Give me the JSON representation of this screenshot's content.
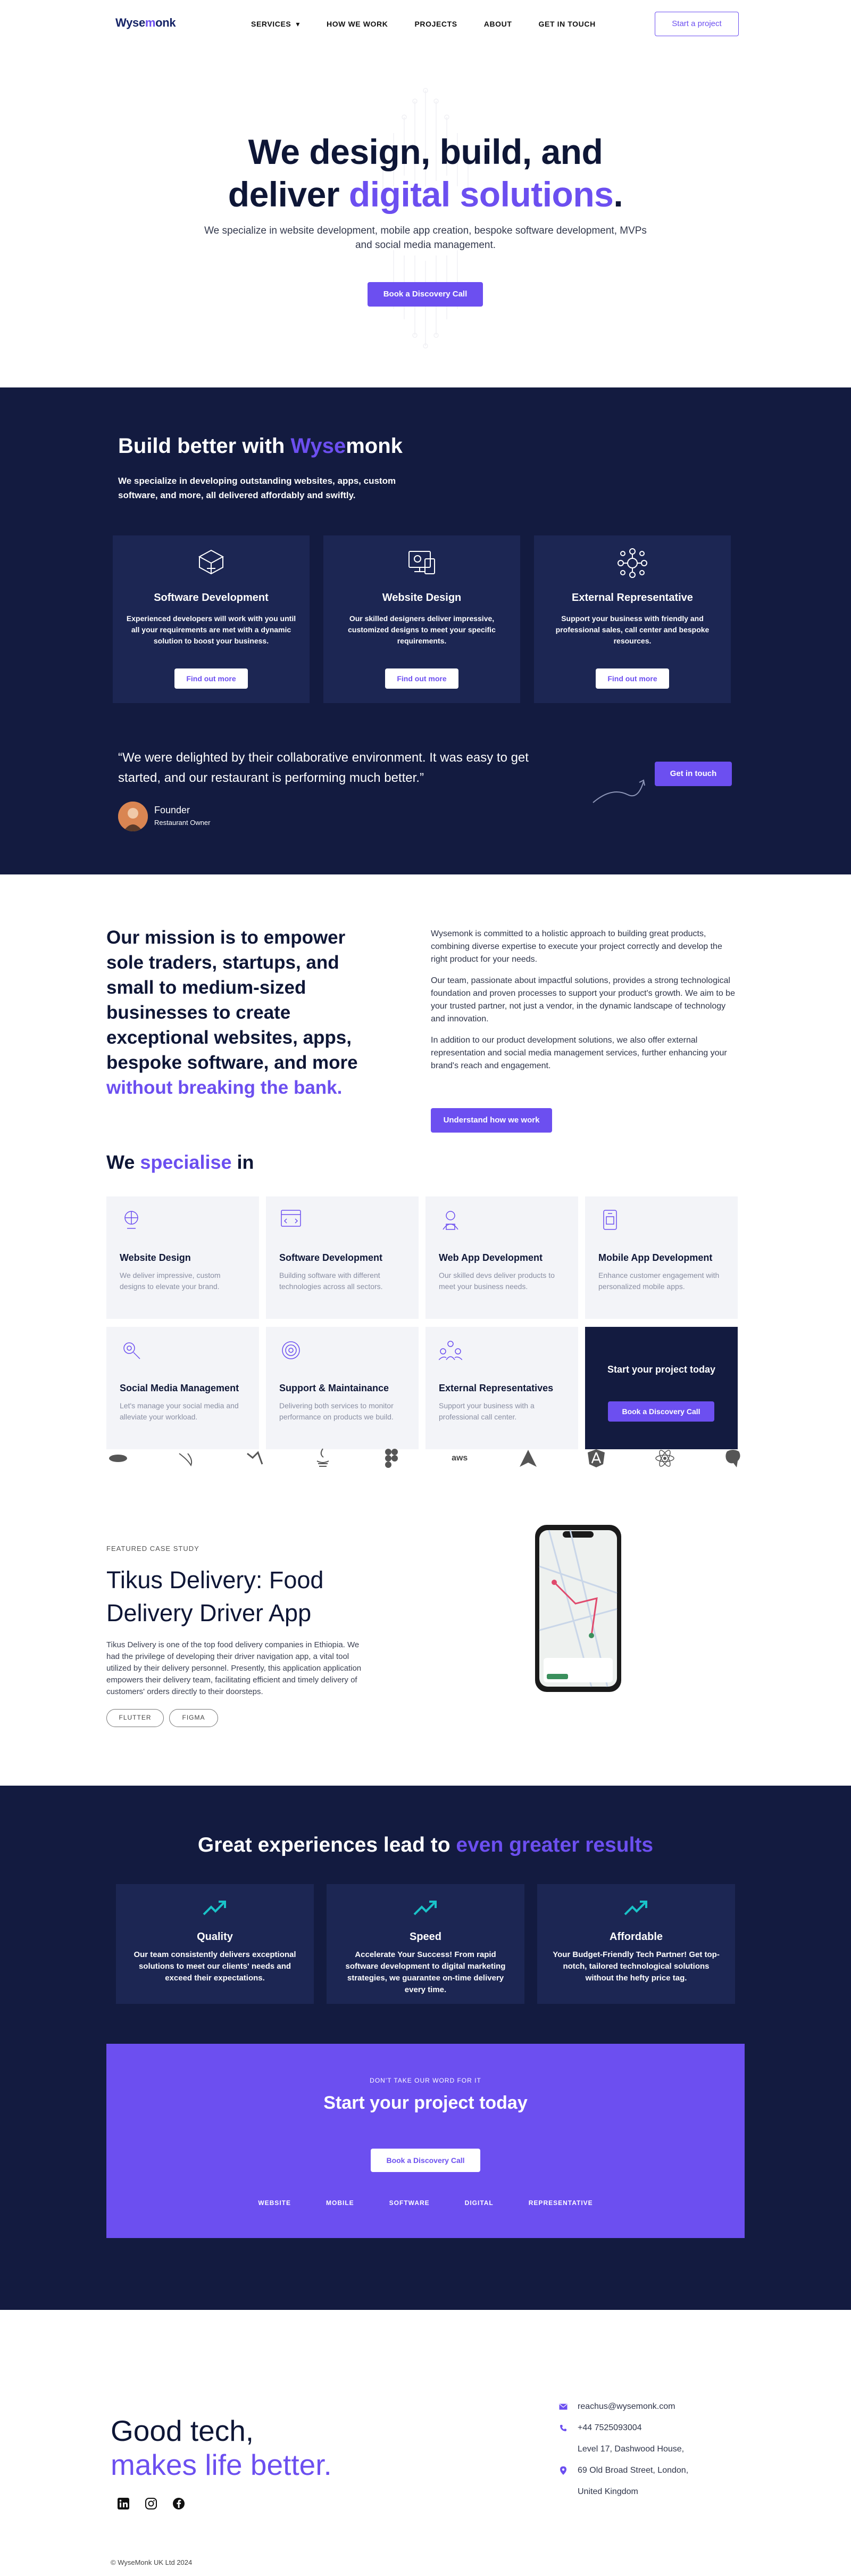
{
  "nav": {
    "logo_prefix": "Wyse",
    "logo_o": "m",
    "logo_suffix": "onk",
    "links": [
      "SERVICES",
      "HOW WE WORK",
      "PROJECTS",
      "ABOUT",
      "GET IN TOUCH"
    ],
    "services_chevron": "▾",
    "cta": "Start a project"
  },
  "hero": {
    "title_line1": "We design, build, and",
    "title_line2_prefix": "deliver ",
    "title_line2_accent": "digital solutions",
    "title_line2_suffix": ".",
    "subtitle": "We specialize in website development, mobile app creation, bespoke software development, MVPs and social media management.",
    "cta": "Book a Discovery Call"
  },
  "build": {
    "title_prefix": "Build better with ",
    "title_brand_a": "Wyse",
    "title_brand_b": "monk",
    "subtitle": "We specialize in developing outstanding websites, apps, custom software, and more, all delivered affordably and swiftly.",
    "cards": [
      {
        "icon": "software-icon",
        "title": "Software Development",
        "body": "Experienced developers will work with you until all your requirements are met with a dynamic solution to boost your business.",
        "cta": "Find out more"
      },
      {
        "icon": "website-design-icon",
        "title": "Website Design",
        "body": "Our skilled designers deliver impressive, customized designs to meet your specific requirements.",
        "cta": "Find out more"
      },
      {
        "icon": "network-icon",
        "title": "External Representative",
        "body": "Support your business with friendly and professional sales, call center and bespoke resources.",
        "cta": "Find out more"
      }
    ],
    "testimonial": {
      "quote": "“We were delighted by their collaborative environment. It was easy to get started, and our restaurant is performing much better.”",
      "name": "Founder",
      "role": "Restaurant Owner"
    },
    "cta": "Get in touch"
  },
  "mission": {
    "title": "Our mission is to empower sole traders, startups, and small to medium-sized businesses to create exceptional websites, apps, bespoke software, and more",
    "title_accent": "without breaking the bank.",
    "paragraphs": [
      "Wysemonk is committed to a holistic approach to building great products, combining diverse expertise to execute your project correctly and develop the right product for your needs.",
      "Our team, passionate about impactful solutions, provides a strong technological foundation and proven processes to support your product's growth. We aim to be your trusted partner, not just a vendor, in the dynamic landscape of technology and innovation.",
      "In addition to our product development solutions, we also offer external representation and social media management services, further enhancing your brand's reach and engagement."
    ],
    "cta": "Understand how we work"
  },
  "specialise": {
    "title_prefix": "We ",
    "title_accent": "specialise",
    "title_suffix": " in",
    "cards": [
      {
        "icon": "website-design-icon",
        "title": "Website Design",
        "body": "We deliver impressive, custom designs to elevate your brand."
      },
      {
        "icon": "software-dev-icon",
        "title": "Software Development",
        "body": "Building  software with different technologies across all sectors."
      },
      {
        "icon": "web-app-dev-icon",
        "title": "Web App Development",
        "body": "Our skilled devs deliver products to meet your business needs."
      },
      {
        "icon": "mobile-app-icon",
        "title": "Mobile App Development",
        "body": "Enhance customer engagement with personalized mobile apps."
      },
      {
        "icon": "social-media-icon",
        "title": "Social Media Management",
        "body": "Let's manage your social media and alleviate your workload."
      },
      {
        "icon": "support-icon",
        "title": "Support & Maintainance",
        "body": "Delivering both services to monitor performance on products we build."
      },
      {
        "icon": "external-reps-icon",
        "title": "External Representatives",
        "body": "Support your business with a professional call center."
      }
    ],
    "cta_title": "Start your project today",
    "cta_button": "Book a Discovery Call",
    "techs": [
      "mysql-icon",
      "swift-icon",
      "dart-icon",
      "java-icon",
      "figma-icon",
      "aws-icon",
      "arch-icon",
      "angular-icon",
      "react-icon",
      "postgresql-icon"
    ],
    "aws_label": "aws"
  },
  "case": {
    "kicker": "FEATURED CASE STUDY",
    "title": "Tikus Delivery: Food Delivery Driver App",
    "body": "Tikus Delivery is one of the top food delivery companies in Ethiopia. We had the privilege of developing their driver navigation app, a vital tool utilized by their delivery personnel. Presently, this application application empowers their delivery team, facilitating efficient and timely delivery of customers' orders directly to their doorsteps.",
    "tags": [
      "FLUTTER",
      "FIGMA"
    ]
  },
  "results": {
    "title_prefix": "Great experiences lead to ",
    "title_accent": "even greater results",
    "cards": [
      {
        "title": "Quality",
        "body": "Our team consistently delivers exceptional solutions to meet our clients' needs and exceed their expectations."
      },
      {
        "title": "Speed",
        "body": "Accelerate Your Success! From rapid software development to digital marketing strategies, we guarantee on-time delivery every time."
      },
      {
        "title": "Affordable",
        "body": "Your Budget-Friendly Tech Partner! Get top-notch, tailored technological solutions without the hefty price tag."
      }
    ]
  },
  "promo": {
    "kicker": "DON'T TAKE OUR WORD FOR IT",
    "title": "Start your project today",
    "cta": "Book a Discovery Call",
    "links": [
      "WEBSITE",
      "MOBILE",
      "SOFTWARE",
      "DIGITAL",
      "REPRESENTATIVE"
    ]
  },
  "footer": {
    "title_line1": "Good tech,",
    "title_line2": "makes life better.",
    "email": "reachus@wysemonk.com",
    "phone": "+44 7525093004",
    "address1": "Level 17, Dashwood House,",
    "address2": "69 Old Broad Street, London,",
    "address3": "United Kingdom",
    "copyright": "© WyseMonk UK Ltd 2024"
  },
  "colors": {
    "accent": "#6c4ff0",
    "navy": "#131b40",
    "card": "#1c2653",
    "teal": "#19c3c8"
  }
}
